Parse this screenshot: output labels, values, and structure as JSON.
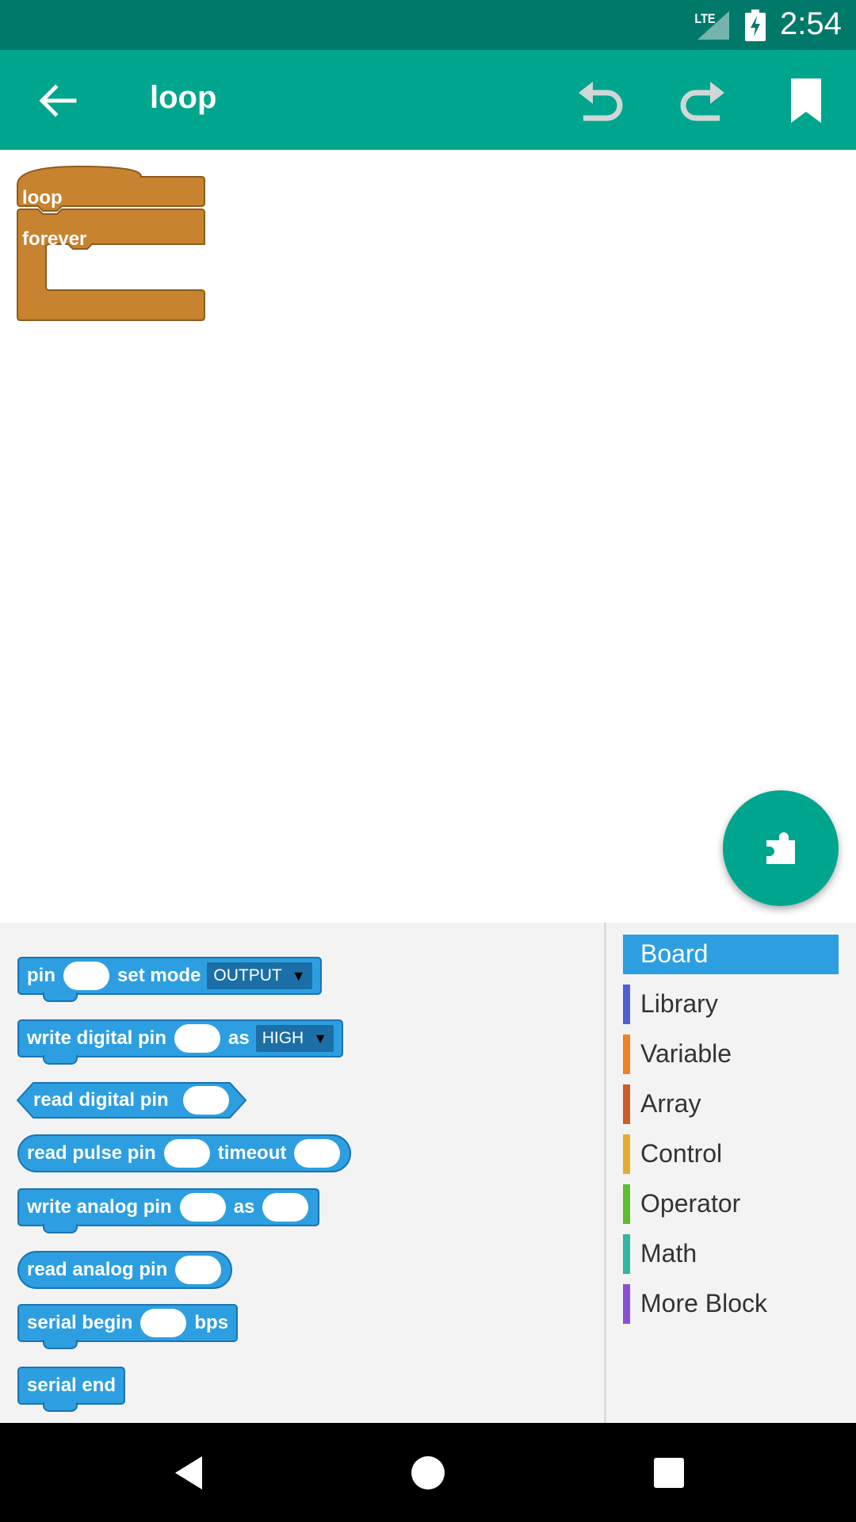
{
  "status_bar": {
    "network": "LTE",
    "time": "2:54",
    "signal_icon": "signal-icon",
    "battery_icon": "battery-charging-icon"
  },
  "app_bar": {
    "title": "loop",
    "icons": [
      "back-arrow-icon",
      "undo-icon",
      "redo-icon",
      "bookmark-icon"
    ]
  },
  "canvas": {
    "blocks": [
      {
        "label": "loop",
        "color": "#c88330"
      },
      {
        "label": "forever",
        "color": "#c88330"
      }
    ],
    "fab_icon": "puzzle-piece-icon"
  },
  "palette": {
    "blocks": [
      {
        "parts": [
          "pin",
          "set mode"
        ],
        "dropdown": "OUTPUT"
      },
      {
        "parts": [
          "write digital pin",
          "as"
        ],
        "dropdown": "HIGH"
      },
      {
        "parts": [
          "read digital pin"
        ]
      },
      {
        "parts": [
          "read pulse pin",
          "timeout"
        ]
      },
      {
        "parts": [
          "write analog pin",
          "as"
        ]
      },
      {
        "parts": [
          "read analog pin"
        ]
      },
      {
        "parts": [
          "serial begin",
          "bps"
        ]
      },
      {
        "parts": [
          "serial end"
        ]
      }
    ],
    "block_color": "#2d9fe0"
  },
  "categories": [
    {
      "label": "Board",
      "color": "#2d9fe0",
      "selected": true
    },
    {
      "label": "Library",
      "color": "#4d60d6"
    },
    {
      "label": "Variable",
      "color": "#ef8220"
    },
    {
      "label": "Array",
      "color": "#cf5b2b"
    },
    {
      "label": "Control",
      "color": "#e6ac2e"
    },
    {
      "label": "Operator",
      "color": "#5bbf2d"
    },
    {
      "label": "Math",
      "color": "#2cb9a4"
    },
    {
      "label": "More Block",
      "color": "#8b4fd6"
    }
  ],
  "nav_bar": {
    "icons": [
      "back-triangle-icon",
      "home-circle-icon",
      "recents-square-icon"
    ]
  }
}
